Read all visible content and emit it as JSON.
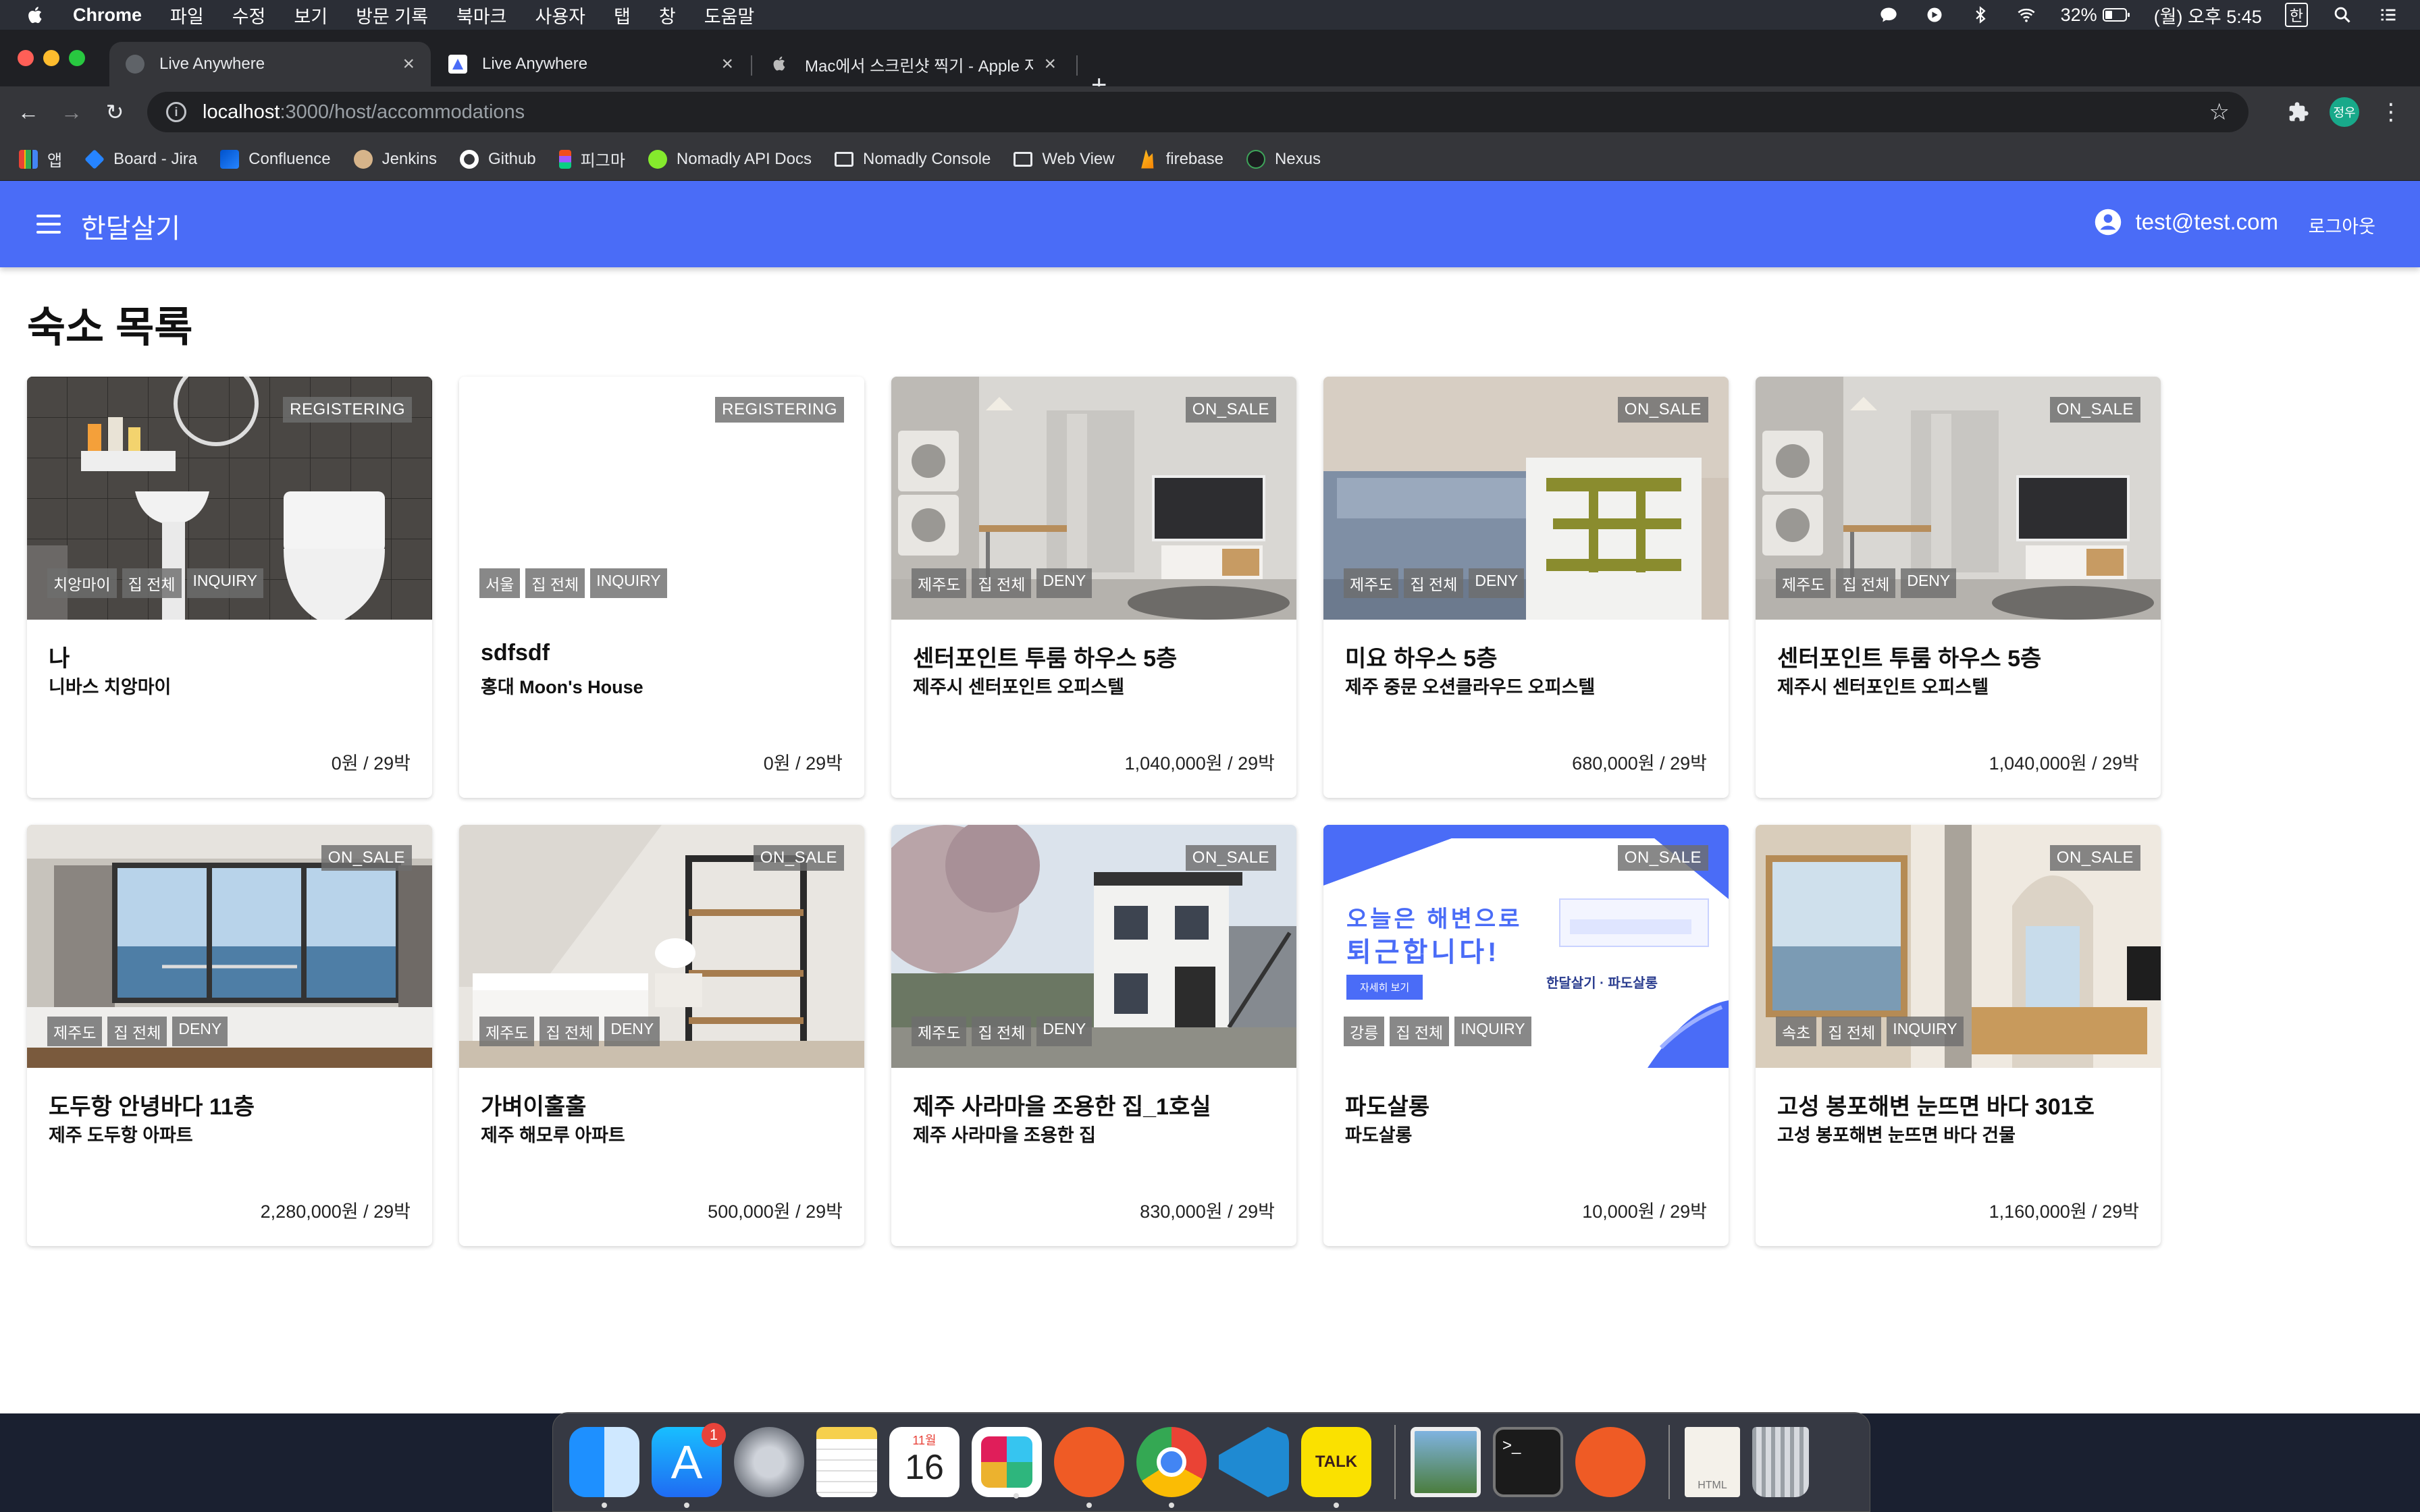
{
  "menubar": {
    "items": [
      "Chrome",
      "파일",
      "수정",
      "보기",
      "방문 기록",
      "북마크",
      "사용자",
      "탭",
      "창",
      "도움말"
    ],
    "battery": "32%",
    "clock": "(월) 오후 5:45",
    "input_method": "한"
  },
  "tabs": [
    {
      "title": "Live Anywhere",
      "active": true
    },
    {
      "title": "Live Anywhere",
      "active": false
    },
    {
      "title": "Mac에서 스크린샷 찍기 - Apple 지",
      "active": false
    }
  ],
  "address": {
    "host": "localhost",
    "path": ":3000/host/accommodations"
  },
  "profile_initials": "정우",
  "bookmarks": [
    "앱",
    "Board - Jira",
    "Confluence",
    "Jenkins",
    "Github",
    "피그마",
    "Nomadly API Docs",
    "Nomadly Console",
    "Web View",
    "firebase",
    "Nexus"
  ],
  "appbar": {
    "brand": "한달살기",
    "user_email": "test@test.com",
    "logout_label": "로그아웃"
  },
  "page": {
    "title": "숙소 목록"
  },
  "listings": [
    {
      "status": "REGISTERING",
      "chips": [
        "치앙마이",
        "집 전체",
        "INQUIRY"
      ],
      "name": "나",
      "subtitle": "니바스 치앙마이",
      "price": "0원 / 29박"
    },
    {
      "status": "REGISTERING",
      "chips": [
        "서울",
        "집 전체",
        "INQUIRY"
      ],
      "name": "sdfsdf",
      "subtitle": "홍대 Moon's House",
      "price": "0원 / 29박"
    },
    {
      "status": "ON_SALE",
      "chips": [
        "제주도",
        "집 전체",
        "DENY"
      ],
      "name": "센터포인트 투룸 하우스 5층",
      "subtitle": "제주시 센터포인트 오피스텔",
      "price": "1,040,000원 / 29박"
    },
    {
      "status": "ON_SALE",
      "chips": [
        "제주도",
        "집 전체",
        "DENY"
      ],
      "name": "미요 하우스 5층",
      "subtitle": "제주 중문 오션클라우드 오피스텔",
      "price": "680,000원 / 29박"
    },
    {
      "status": "ON_SALE",
      "chips": [
        "제주도",
        "집 전체",
        "DENY"
      ],
      "name": "센터포인트 투룸 하우스 5층",
      "subtitle": "제주시 센터포인트 오피스텔",
      "price": "1,040,000원 / 29박"
    },
    {
      "status": "ON_SALE",
      "chips": [
        "제주도",
        "집 전체",
        "DENY"
      ],
      "name": "도두항 안녕바다 11층",
      "subtitle": "제주 도두항 아파트",
      "price": "2,280,000원 / 29박"
    },
    {
      "status": "ON_SALE",
      "chips": [
        "제주도",
        "집 전체",
        "DENY"
      ],
      "name": "가벼이훌훌",
      "subtitle": "제주 해모루 아파트",
      "price": "500,000원 / 29박"
    },
    {
      "status": "ON_SALE",
      "chips": [
        "제주도",
        "집 전체",
        "DENY"
      ],
      "name": "제주 사라마을 조용한 집_1호실",
      "subtitle": "제주 사라마을 조용한 집",
      "price": "830,000원 / 29박"
    },
    {
      "status": "ON_SALE",
      "chips": [
        "강릉",
        "집 전체",
        "INQUIRY"
      ],
      "name": "파도살롱",
      "subtitle": "파도살롱",
      "price": "10,000원 / 29박",
      "banner": {
        "line1": "오늘은 해변으로",
        "line2": "퇴근합니다!",
        "button": "자세히 보기",
        "logo": "한달살기 · 파도살롱"
      }
    },
    {
      "status": "ON_SALE",
      "chips": [
        "속초",
        "집 전체",
        "INQUIRY"
      ],
      "name": "고성 봉포해변 눈뜨면 바다 301호",
      "subtitle": "고성 봉포해변 눈뜨면 바다 건물",
      "price": "1,160,000원 / 29박"
    }
  ],
  "dock": {
    "apps": [
      "finder-icon",
      "app-store-icon",
      "launchpad-icon",
      "notes-icon",
      "calendar-icon",
      "slack-icon",
      "postman-icon",
      "chrome-icon",
      "vscode-icon",
      "kakaotalk-icon",
      "preview-icon",
      "terminal-icon",
      "postman-icon",
      "html-file-icon",
      "trash-icon"
    ],
    "app_store_badge": "1",
    "calendar_month": "11월",
    "calendar_day": "16",
    "kakao_label": "TALK",
    "html_label": "HTML"
  },
  "colors": {
    "appbar": "#4a6cf7",
    "chip_bg": "#6e6e6e"
  }
}
